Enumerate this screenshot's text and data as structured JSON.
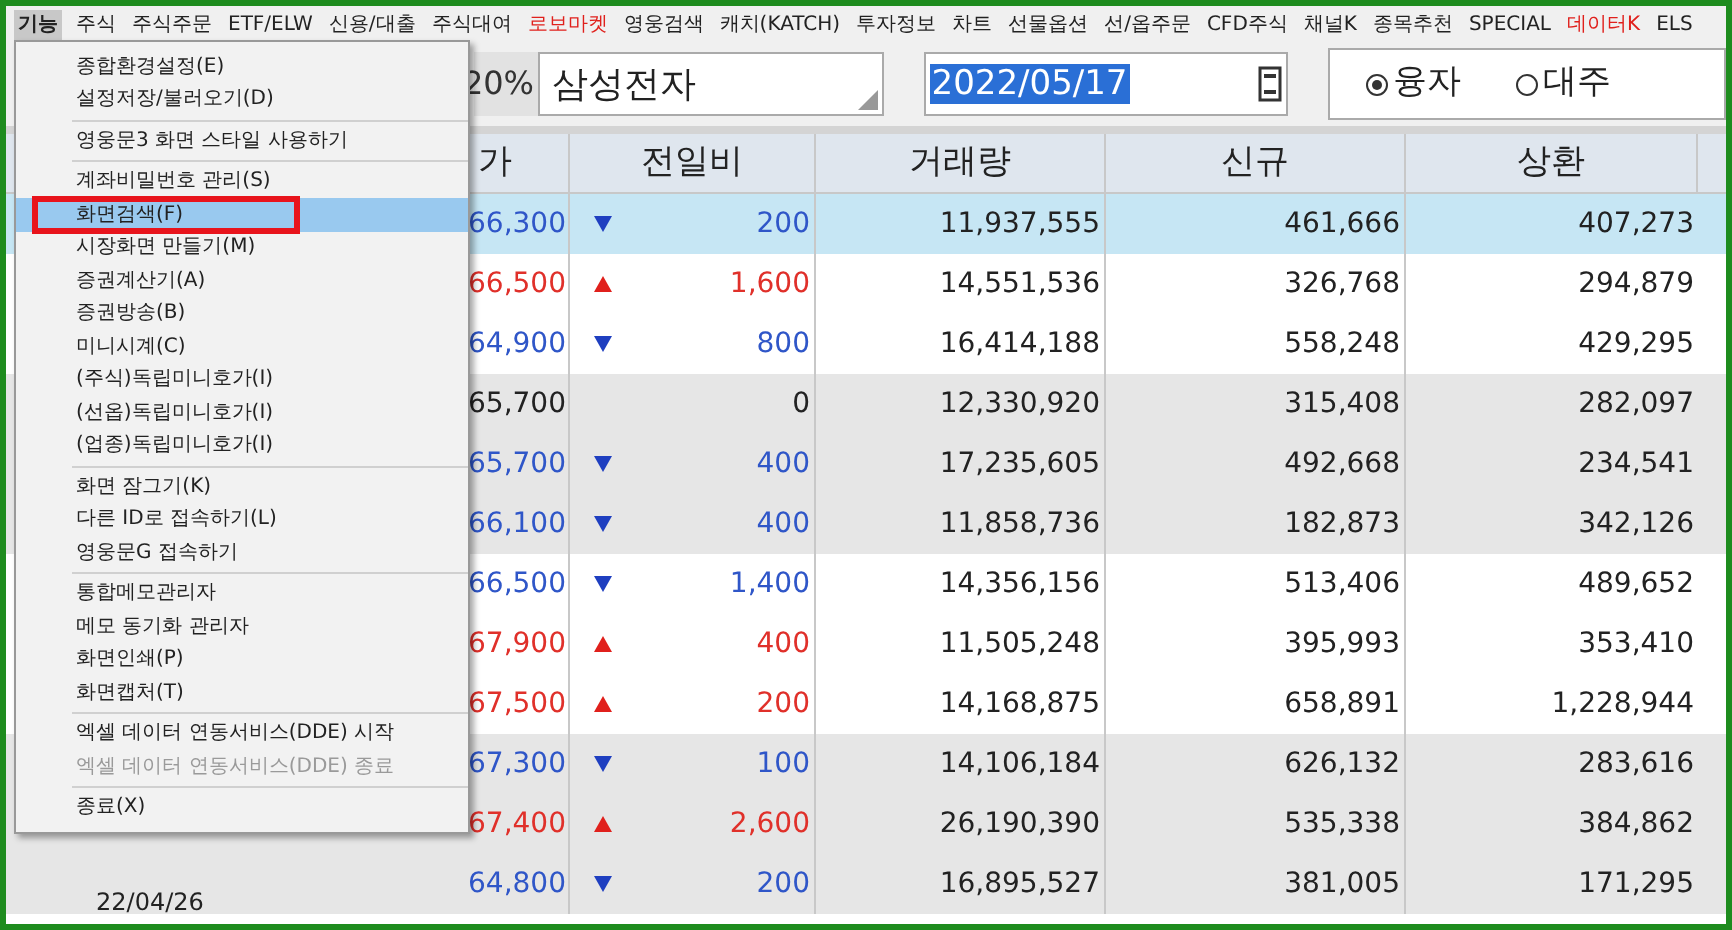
{
  "menubar": [
    {
      "label": "기능",
      "selected": true,
      "color": "#222222"
    },
    {
      "label": "주식",
      "selected": false,
      "color": "#222222"
    },
    {
      "label": "주식주문",
      "selected": false,
      "color": "#222222"
    },
    {
      "label": "ETF/ELW",
      "selected": false,
      "color": "#222222"
    },
    {
      "label": "신용/대출",
      "selected": false,
      "color": "#222222"
    },
    {
      "label": "주식대여",
      "selected": false,
      "color": "#222222"
    },
    {
      "label": "로보마켓",
      "selected": false,
      "color": "#e0201c"
    },
    {
      "label": "영웅검색",
      "selected": false,
      "color": "#222222"
    },
    {
      "label": "캐치(KATCH)",
      "selected": false,
      "color": "#222222"
    },
    {
      "label": "투자정보",
      "selected": false,
      "color": "#222222"
    },
    {
      "label": "차트",
      "selected": false,
      "color": "#222222"
    },
    {
      "label": "선물옵션",
      "selected": false,
      "color": "#222222"
    },
    {
      "label": "선/옵주문",
      "selected": false,
      "color": "#222222"
    },
    {
      "label": "CFD주식",
      "selected": false,
      "color": "#222222"
    },
    {
      "label": "채널K",
      "selected": false,
      "color": "#222222"
    },
    {
      "label": "종목추천",
      "selected": false,
      "color": "#222222"
    },
    {
      "label": "SPECIAL",
      "selected": false,
      "color": "#222222"
    },
    {
      "label": "데이터K",
      "selected": false,
      "color": "#e0201c"
    },
    {
      "label": "ELS",
      "selected": false,
      "color": "#222222"
    }
  ],
  "dropdown_menu": [
    [
      {
        "label": "종합환경설정(E)",
        "selected": false,
        "disabled": false
      },
      {
        "label": "설정저장/불러오기(D)",
        "selected": false,
        "disabled": false
      }
    ],
    [
      {
        "label": "영웅문3 화면 스타일 사용하기",
        "selected": false,
        "disabled": false
      }
    ],
    [
      {
        "label": "계좌비밀번호 관리(S)",
        "selected": false,
        "disabled": false
      },
      {
        "label": "화면검색(F)",
        "selected": true,
        "disabled": false
      },
      {
        "label": "시장화면 만들기(M)",
        "selected": false,
        "disabled": false
      },
      {
        "label": "증권계산기(A)",
        "selected": false,
        "disabled": false
      },
      {
        "label": "증권방송(B)",
        "selected": false,
        "disabled": false
      },
      {
        "label": "미니시계(C)",
        "selected": false,
        "disabled": false
      },
      {
        "label": "(주식)독립미니호가(I)",
        "selected": false,
        "disabled": false
      },
      {
        "label": "(선옵)독립미니호가(I)",
        "selected": false,
        "disabled": false
      },
      {
        "label": "(업종)독립미니호가(I)",
        "selected": false,
        "disabled": false
      }
    ],
    [
      {
        "label": "화면 잠그기(K)",
        "selected": false,
        "disabled": false
      },
      {
        "label": "다른 ID로 접속하기(L)",
        "selected": false,
        "disabled": false
      },
      {
        "label": "영웅문G 접속하기",
        "selected": false,
        "disabled": false
      }
    ],
    [
      {
        "label": "통합메모관리자",
        "selected": false,
        "disabled": false
      },
      {
        "label": "메모 동기화 관리자",
        "selected": false,
        "disabled": false
      },
      {
        "label": "화면인쇄(P)",
        "selected": false,
        "disabled": false
      },
      {
        "label": "화면캡처(T)",
        "selected": false,
        "disabled": false
      }
    ],
    [
      {
        "label": "엑셀 데이터 연동서비스(DDE) 시작",
        "selected": false,
        "disabled": false
      },
      {
        "label": "엑셀 데이터 연동서비스(DDE) 종료",
        "selected": false,
        "disabled": true
      }
    ],
    [
      {
        "label": "종료(X)",
        "selected": false,
        "disabled": false
      }
    ]
  ],
  "toolbar": {
    "ratio": "20%",
    "stock_name": "삼성전자",
    "date": "2022/05/17",
    "radios": [
      {
        "label": "융자",
        "selected": true
      },
      {
        "label": "대주",
        "selected": false
      }
    ]
  },
  "table": {
    "columns": [
      "가",
      "전일비",
      "거래량",
      "신규",
      "상환"
    ],
    "rows": [
      {
        "price": "66,300",
        "kind": "down",
        "diff": "200",
        "volume": "11,937,555",
        "new": "461,666",
        "repay": "407,273",
        "selected": true
      },
      {
        "price": "66,500",
        "kind": "up",
        "diff": "1,600",
        "volume": "14,551,536",
        "new": "326,768",
        "repay": "294,879",
        "selected": false
      },
      {
        "price": "64,900",
        "kind": "down",
        "diff": "800",
        "volume": "16,414,188",
        "new": "558,248",
        "repay": "429,295",
        "selected": false
      },
      {
        "price": "65,700",
        "kind": "none",
        "diff": "0",
        "volume": "12,330,920",
        "new": "315,408",
        "repay": "282,097",
        "selected": false
      },
      {
        "price": "65,700",
        "kind": "down",
        "diff": "400",
        "volume": "17,235,605",
        "new": "492,668",
        "repay": "234,541",
        "selected": false
      },
      {
        "price": "66,100",
        "kind": "down",
        "diff": "400",
        "volume": "11,858,736",
        "new": "182,873",
        "repay": "342,126",
        "selected": false
      },
      {
        "price": "66,500",
        "kind": "down",
        "diff": "1,400",
        "volume": "14,356,156",
        "new": "513,406",
        "repay": "489,652",
        "selected": false
      },
      {
        "price": "67,900",
        "kind": "up",
        "diff": "400",
        "volume": "11,505,248",
        "new": "395,993",
        "repay": "353,410",
        "selected": false
      },
      {
        "price": "67,500",
        "kind": "up",
        "diff": "200",
        "volume": "14,168,875",
        "new": "658,891",
        "repay": "1,228,944",
        "selected": false
      },
      {
        "price": "67,300",
        "kind": "down",
        "diff": "100",
        "volume": "14,106,184",
        "new": "626,132",
        "repay": "283,616",
        "selected": false
      },
      {
        "price": "67,400",
        "kind": "up",
        "diff": "2,600",
        "volume": "26,190,390",
        "new": "535,338",
        "repay": "384,862",
        "selected": false
      },
      {
        "date": "22/04/26",
        "price": "64,800",
        "kind": "down",
        "diff": "200",
        "volume": "16,895,527",
        "new": "381,005",
        "repay": "171,295",
        "selected": false
      }
    ]
  }
}
